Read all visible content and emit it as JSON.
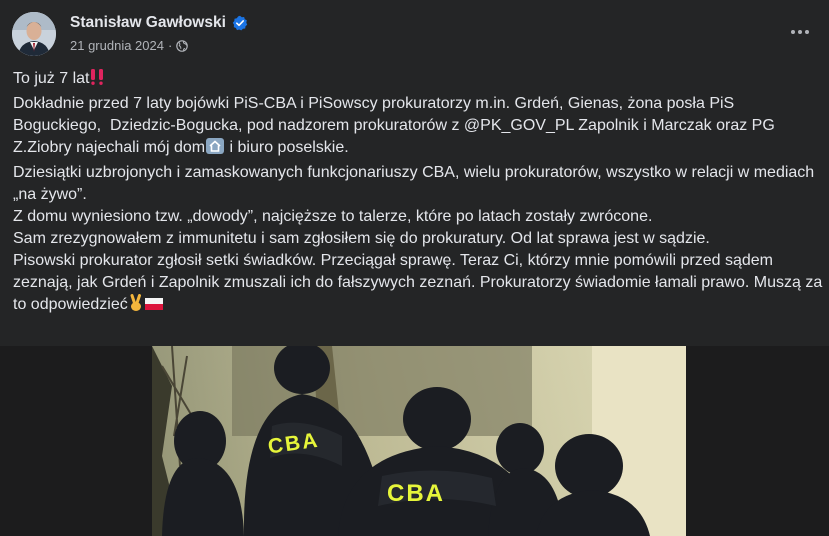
{
  "post": {
    "author": "Stanisław Gawłowski",
    "date": "21 grudnia 2024",
    "separator": "·",
    "privacy_icon": "globe-icon",
    "more_icon": "more-horizontal-icon",
    "verified_icon": "verified-badge-icon",
    "accent_color": "#1b74e4"
  },
  "text": {
    "line1": "To już 7 lat",
    "line2": "Dokładnie przed 7 laty bojówki PiS-CBA i PiSowscy prokuratorzy m.in. Grdeń, Gienas, żona posła PiS Boguckiego,  Dziedzic-Bogucka, pod nadzorem prokuratorów z @PK_GOV_PL Zapolnik i Marczak oraz PG Z.Ziobry najechali mój dom",
    "line2_end": " i biuro poselskie.",
    "line3": "Dziesiątki uzbrojonych i zamaskowanych funkcjonariuszy CBA, wielu prokuratorów, wszystko w relacji w mediach „na żywo”.",
    "line4": "Z domu wyniesiono tzw. „dowody”, najcięższe to talerze, które po latach zostały zwrócone.",
    "line5": "Sam zrezygnowałem z immunitetu i sam zgłosiłem się do prokuratury. Od lat sprawa jest w sądzie.",
    "line6": "Pisowski prokurator zgłosił setki świadków. Przeciągał sprawę. Teraz Ci, którzy mnie pomówili przed sądem zeznają, jak Grdeń i Zapolnik zmuszali ich do fałszywych zeznań. Prokuratorzy świadomie łamali prawo. Muszą za to odpowiedzieć"
  },
  "photo": {
    "jacket_text_1": "CBA",
    "jacket_text_2": "CBA",
    "jacket_text_color": "#e6f53a"
  }
}
